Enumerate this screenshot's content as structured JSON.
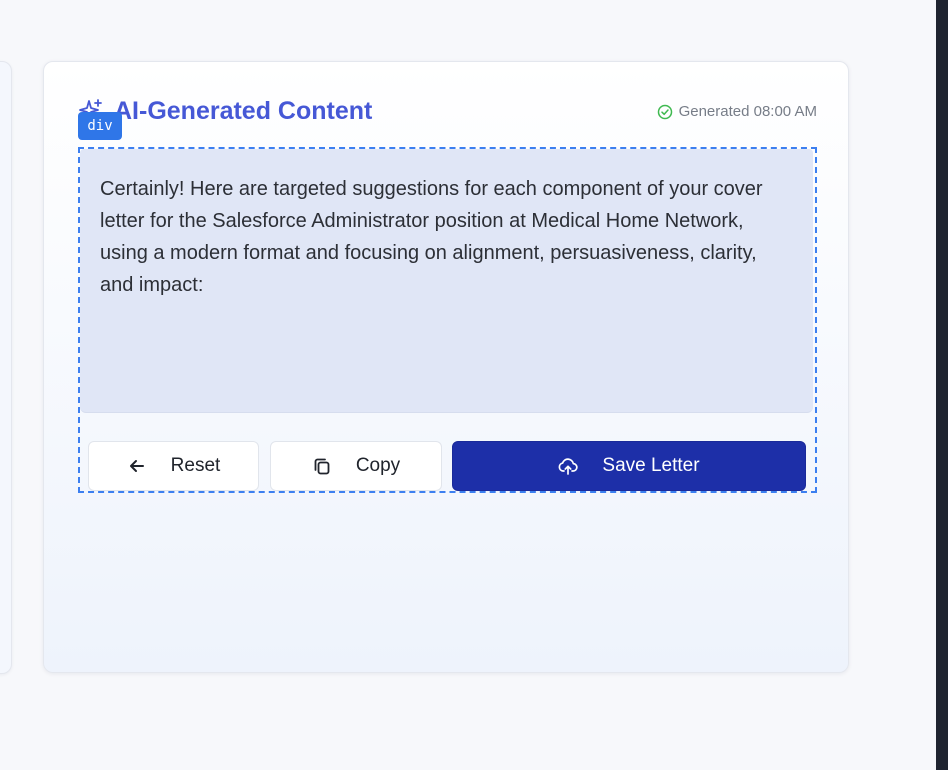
{
  "card": {
    "title": "AI-Generated Content",
    "generated_status": "Generated 08:00 AM"
  },
  "overlay": {
    "tag": "div"
  },
  "content": {
    "text": "Certainly! Here are targeted suggestions for each component of your cover letter for the Salesforce Administrator position at Medical Home Network, using a modern format and focusing on alignment, persuasiveness, clarity, and impact:"
  },
  "actions": {
    "reset_label": "Reset",
    "copy_label": "Copy",
    "save_label": "Save Letter"
  },
  "icons": {
    "title": "sparkles-icon",
    "status": "check-circle-icon",
    "reset": "arrow-left-icon",
    "copy": "copy-icon",
    "save": "cloud-upload-icon"
  },
  "colors": {
    "accent": "#4658d6",
    "primary_button": "#1d2fa8",
    "success": "#3fb950",
    "selection": "#3c7ff0"
  }
}
